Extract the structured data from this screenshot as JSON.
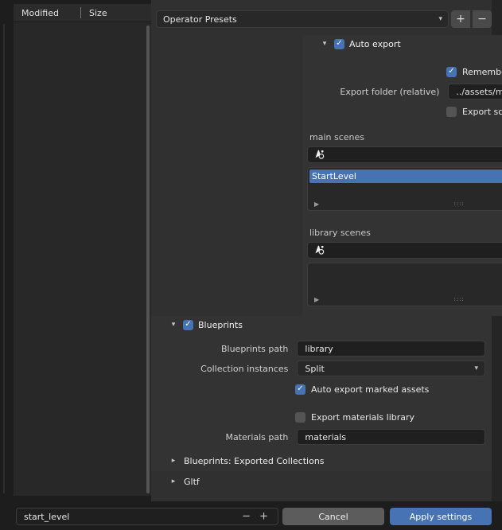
{
  "file_browser": {
    "columns": [
      "Modified",
      "Size"
    ]
  },
  "properties": {
    "preset": {
      "value": "Operator Presets",
      "add_label": "+",
      "remove_label": "−"
    },
    "auto_export": {
      "title": "Auto export",
      "checked": true,
      "remember_export_settings": {
        "label": "Remember Export Settings",
        "checked": true
      },
      "export_folder": {
        "label": "Export folder (relative)",
        "value": "../assets/models"
      },
      "export_scene_settings": {
        "label": "Export scene settings",
        "checked": false
      }
    },
    "main_scenes": {
      "label": "main scenes",
      "search_value": "",
      "items": [
        {
          "name": "StartLevel",
          "selected": true
        }
      ],
      "add_label": "+",
      "remove_label": "−"
    },
    "library_scenes": {
      "label": "library scenes",
      "search_value": "",
      "items": [],
      "add_label": "+",
      "remove_label": "−"
    },
    "blueprints": {
      "title": "Blueprints",
      "checked": true,
      "blueprints_path": {
        "label": "Blueprints path",
        "value": "library"
      },
      "collection_instances": {
        "label": "Collection instances",
        "value": "Split"
      },
      "auto_export_marked_assets": {
        "label": "Auto export marked assets",
        "checked": true
      },
      "export_materials_library": {
        "label": "Export materials library",
        "checked": false
      },
      "materials_path": {
        "label": "Materials path",
        "value": "materials"
      }
    },
    "collapsed_panels": [
      {
        "title": "Blueprints: Exported Collections"
      },
      {
        "title": "Gltf"
      }
    ]
  },
  "bottom_bar": {
    "filename": "start_level",
    "decrement": "−",
    "increment": "+",
    "cancel_label": "Cancel",
    "apply_label": "Apply settings"
  },
  "colors": {
    "accent_blue": "#4772b3",
    "panel_bg": "#303030",
    "subpanel_bg": "#333333",
    "field_bg": "#1f1f1f",
    "window_bg": "#1d1d1d"
  }
}
